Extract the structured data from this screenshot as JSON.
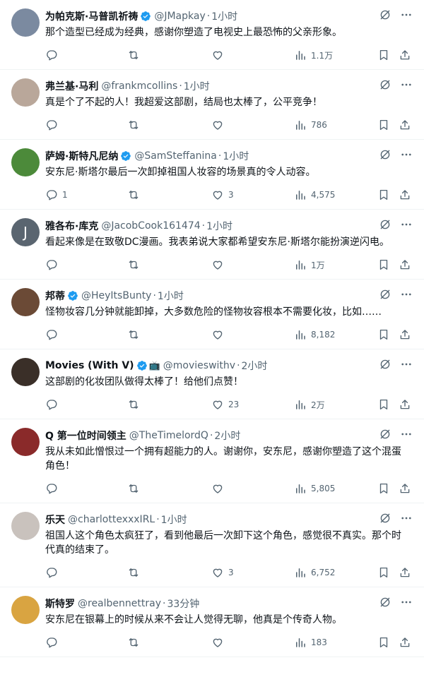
{
  "colors": {
    "verified": "#1d9bf0",
    "muted": "#536471",
    "text": "#0f1419"
  },
  "icons": {
    "reply": "reply-icon",
    "retweet": "retweet-icon",
    "like": "heart-icon",
    "views": "views-icon",
    "bookmark": "bookmark-icon",
    "share": "share-icon",
    "grok": "grok-icon",
    "more": "more-icon"
  },
  "tweets": [
    {
      "name": "为帕克斯·马普凯祈祷",
      "handle": "@JMapkay",
      "dot": "·",
      "time": "1小时",
      "verified": true,
      "text": "那个造型已经成为经典，感谢你塑造了电视史上最恐怖的父亲形象。",
      "replies": "",
      "retweets": "",
      "likes": "",
      "views": "1.1万",
      "avatar_color": "#7b8aa0"
    },
    {
      "name": "弗兰基·马利",
      "handle": "@frankmcollins",
      "dot": "·",
      "time": "1小时",
      "verified": false,
      "text": "真是个了不起的人！我超爱这部剧，结局也太棒了，公平竞争！",
      "replies": "",
      "retweets": "",
      "likes": "",
      "views": "786",
      "avatar_color": "#b9a79a"
    },
    {
      "name": "萨姆·斯特凡尼纳",
      "handle": "@SamSteffanina",
      "dot": "·",
      "time": "1小时",
      "verified": true,
      "text": "安东尼·斯塔尔最后一次卸掉祖国人妆容的场景真的令人动容。",
      "replies": "1",
      "retweets": "",
      "likes": "3",
      "views": "4,575",
      "avatar_color": "#4c8a3a"
    },
    {
      "name": "雅各布·库克",
      "handle": "@JacobCook161474",
      "dot": "·",
      "time": "1小时",
      "verified": false,
      "text": "看起来像是在致敬DC漫画。我表弟说大家都希望安东尼·斯塔尔能扮演逆闪电。",
      "replies": "",
      "retweets": "",
      "likes": "",
      "views": "1万",
      "avatar_color": "#5a6570",
      "avatar_letter": "J"
    },
    {
      "name": "邦蒂",
      "handle": "@HeyItsBunty",
      "dot": "·",
      "time": "1小时",
      "verified": true,
      "text": "怪物妆容几分钟就能卸掉，大多数危险的怪物妆容根本不需要化妆，比如……",
      "replies": "",
      "retweets": "",
      "likes": "",
      "views": "8,182",
      "avatar_color": "#6b4a36"
    },
    {
      "name": "Movies (With V)",
      "handle": "@movieswithv",
      "dot": "·",
      "time": "2小时",
      "verified": true,
      "tv": "📺",
      "text": "这部剧的化妆团队做得太棒了！给他们点赞！",
      "replies": "",
      "retweets": "",
      "likes": "23",
      "views": "2万",
      "avatar_color": "#3a2f28"
    },
    {
      "name": "Q 第一位时间领主",
      "handle": "@TheTimelordQ",
      "dot": "·",
      "time": "2小时",
      "verified": false,
      "text": "我从未如此憎恨过一个拥有超能力的人。谢谢你，安东尼，感谢你塑造了这个混蛋角色！",
      "replies": "",
      "retweets": "",
      "likes": "",
      "views": "5,805",
      "avatar_color": "#8a2a2a"
    },
    {
      "name": "乐天",
      "handle": "@charlottexxxIRL",
      "dot": "·",
      "time": "1小时",
      "verified": false,
      "text": "祖国人这个角色太疯狂了，看到他最后一次卸下这个角色，感觉很不真实。那个时代真的结束了。",
      "replies": "",
      "retweets": "",
      "likes": "3",
      "views": "6,752",
      "avatar_color": "#c9c2bd"
    },
    {
      "name": "斯特罗",
      "handle": "@realbennettray",
      "dot": "·",
      "time": "33分钟",
      "verified": false,
      "text": "安东尼在银幕上的时候从来不会让人觉得无聊，他真是个传奇人物。",
      "replies": "",
      "retweets": "",
      "likes": "",
      "views": "183",
      "avatar_color": "#d9a441"
    }
  ]
}
